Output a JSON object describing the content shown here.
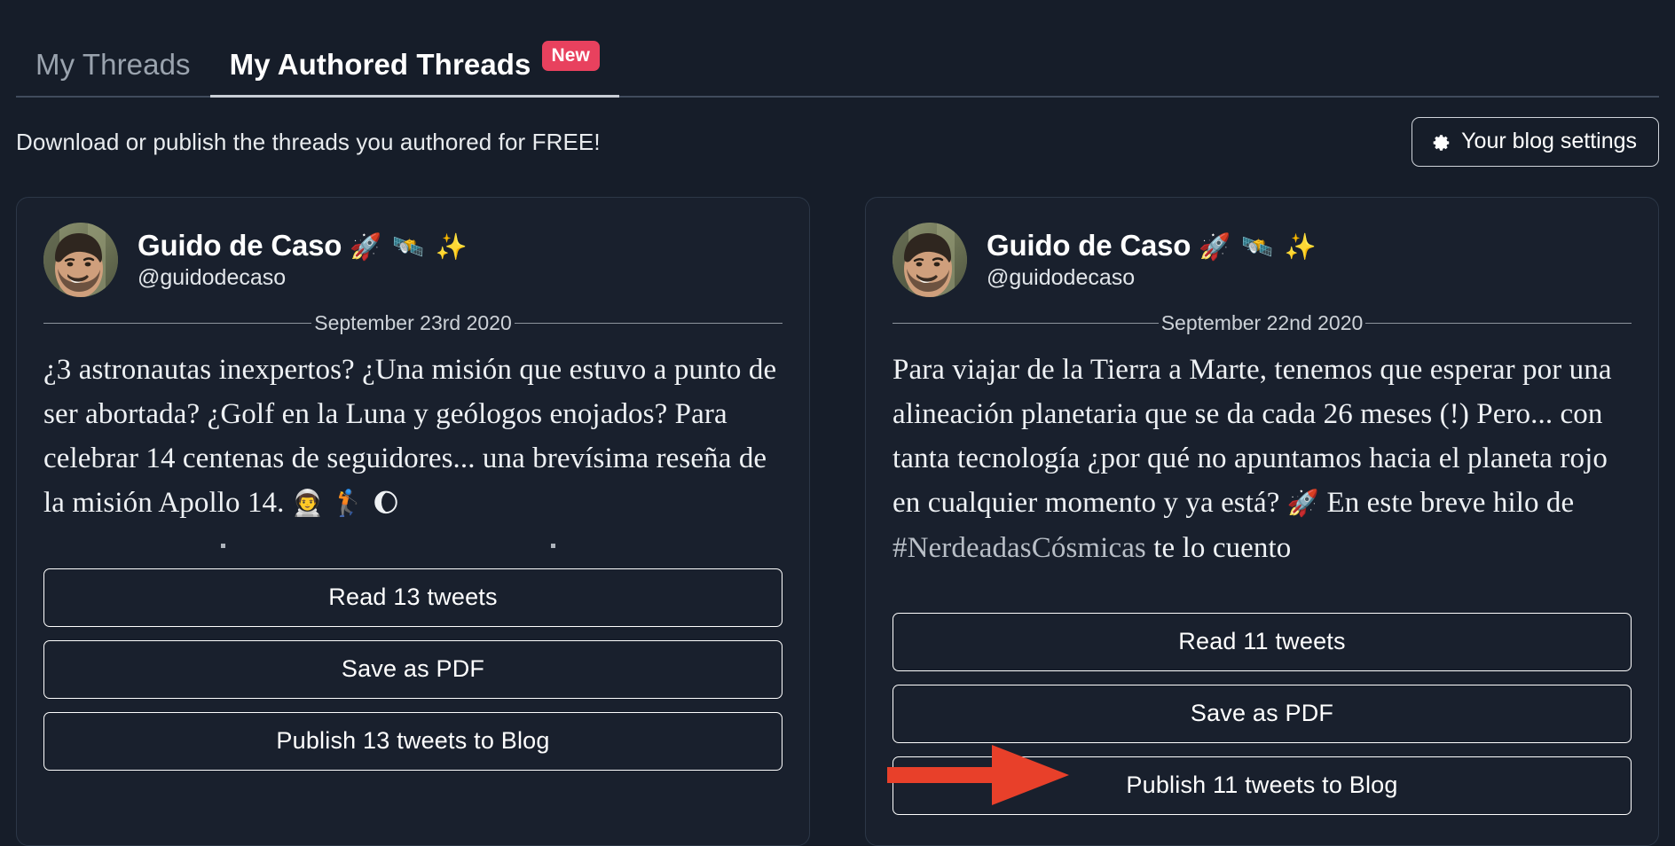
{
  "tabs": [
    {
      "label": "My Threads",
      "active": false,
      "badge": null
    },
    {
      "label": "My Authored Threads",
      "active": true,
      "badge": "New"
    }
  ],
  "subheader": {
    "text": "Download or publish the threads you authored for FREE!",
    "settings_button": "Your blog settings",
    "settings_icon": "gear-icon"
  },
  "colors": {
    "page_background": "#161d29",
    "card_background": "#19202d",
    "card_border": "#2c3747",
    "badge_new": "#e8415e",
    "arrow_red": "#e8402a",
    "text_primary": "#ffffff",
    "tab_inactive": "#9aa3ae"
  },
  "cards": [
    {
      "author": {
        "display_name": "Guido de Caso",
        "name_emojis": "🚀 🛰️ ✨",
        "handle": "@guidodecaso",
        "avatar": "profile-photo"
      },
      "date": "September 23rd 2020",
      "body_prefix": "¿3 astronautas inexpertos? ¿Una misión que estuvo a punto de ser abortada? ¿Golf en la Luna y geólogos enojados? Para celebrar 14 centenas de seguidores... una brevísima reseña de la misión Apollo 14. ",
      "body_emojis": "👨‍🚀 🏌️ 🌔",
      "buttons": {
        "read": "Read 13 tweets",
        "pdf": "Save as PDF",
        "publish": "Publish 13 tweets to Blog"
      }
    },
    {
      "author": {
        "display_name": "Guido de Caso",
        "name_emojis": "🚀 🛰️ ✨",
        "handle": "@guidodecaso",
        "avatar": "profile-photo"
      },
      "date": "September 22nd 2020",
      "body_prefix": "Para viajar de la Tierra a Marte, tenemos que esperar por una alineación planetaria que se da cada 26 meses (!) Pero... con tanta tecnología ¿por qué no apuntamos hacia el planeta rojo en cualquier momento y ya está? ",
      "body_rocket": "🚀",
      "body_middle": " En este breve hilo de ",
      "body_hashtag": "#NerdeadasCósmicas",
      "body_suffix": " te lo cuento",
      "buttons": {
        "read": "Read 11 tweets",
        "pdf": "Save as PDF",
        "publish": "Publish 11 tweets to Blog"
      }
    }
  ],
  "annotation": {
    "type": "red-arrow",
    "points_at": "Publish 11 tweets to Blog"
  }
}
